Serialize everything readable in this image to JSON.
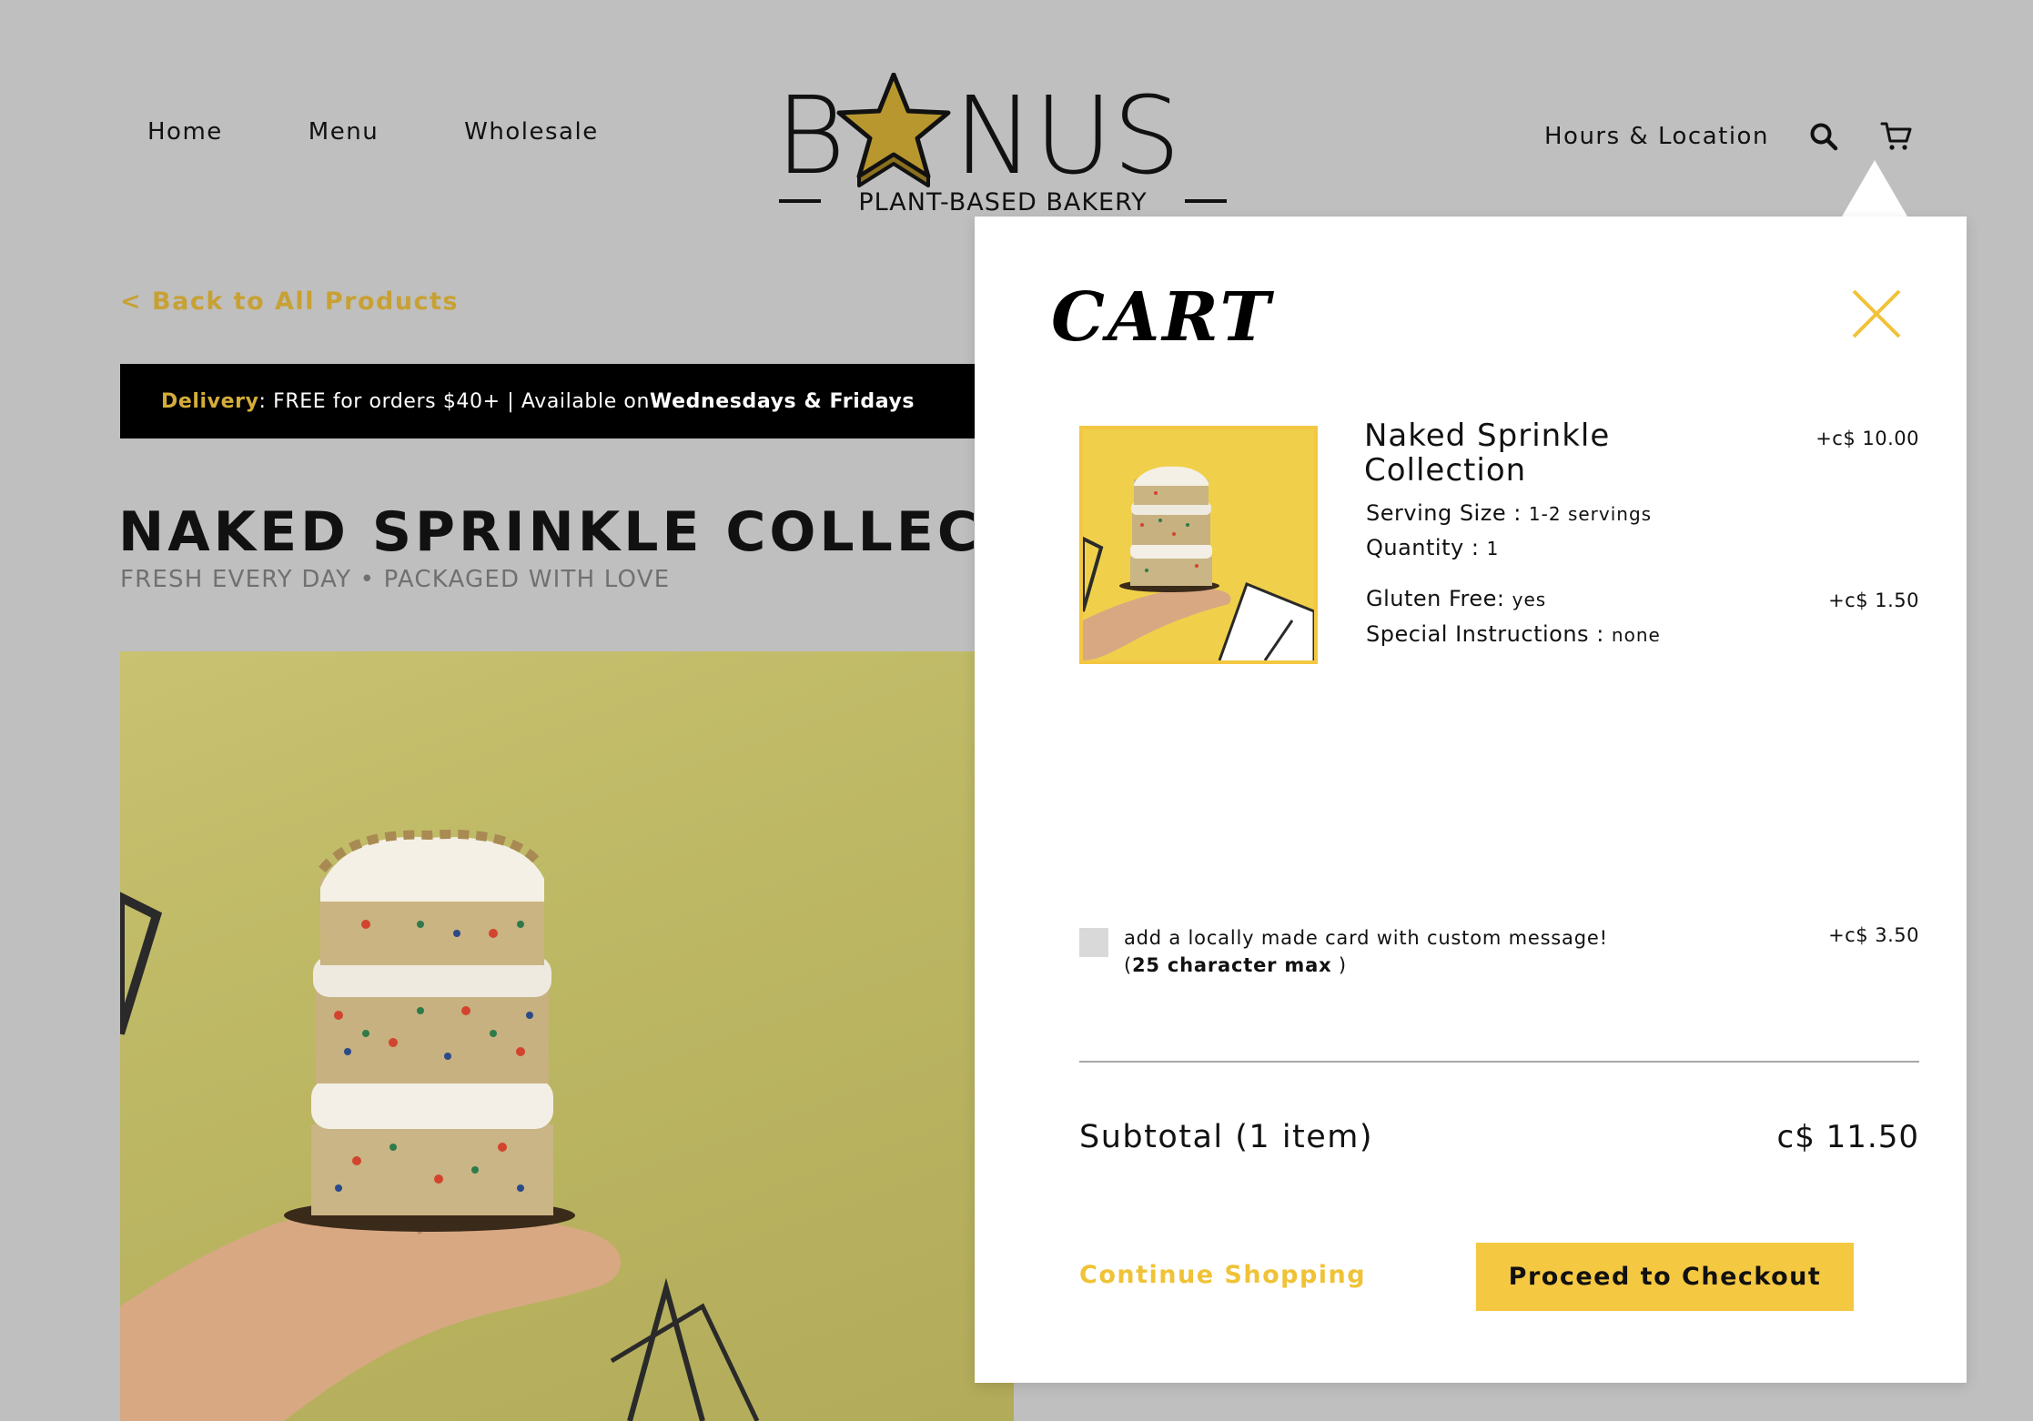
{
  "nav": {
    "left": [
      "Home",
      "Menu",
      "Wholesale"
    ],
    "right_link": "Hours & Location"
  },
  "logo": {
    "wordmark_b": "B",
    "wordmark_rest": "NUS",
    "tagline": "PLANT-BASED BAKERY",
    "star_color": "#b8972f"
  },
  "page": {
    "back_link": "< Back to All Products",
    "delivery": {
      "label": "Delivery",
      "text1": ": FREE for orders $40+ | Available on ",
      "days": "Wednesdays & Fridays"
    },
    "title": "NAKED SPRINKLE COLLECTION",
    "subtitle": "FRESH EVERY DAY • PACKAGED WITH LOVE"
  },
  "cart": {
    "title": "CART",
    "item": {
      "name": "Naked Sprinkle Collection",
      "price": "+c$ 10.00",
      "options": [
        {
          "key": "Serving Size",
          "sep": " : ",
          "value": "1-2 servings"
        },
        {
          "key": "Quantity",
          "sep": " : ",
          "value": "1"
        },
        {
          "key": "Gluten Free",
          "sep": ": ",
          "value": "yes"
        },
        {
          "key": "Special Instructions",
          "sep": " : ",
          "value": "none"
        }
      ],
      "option_price": "+c$ 1.50"
    },
    "card_addon": {
      "line1": "add a locally made card with custom message!",
      "line2_open": "(",
      "line2_bold": "25 character max",
      "line2_close": " )",
      "price": "+c$ 3.50"
    },
    "subtotal": {
      "label": "Subtotal (1 item)",
      "value": "c$ 11.50"
    },
    "continue_label": "Continue Shopping",
    "checkout_label": "Proceed to Checkout"
  },
  "colors": {
    "accent_gold": "#c8a134",
    "checkout_yellow": "#f5c842",
    "page_bg": "#bfbfbf"
  }
}
